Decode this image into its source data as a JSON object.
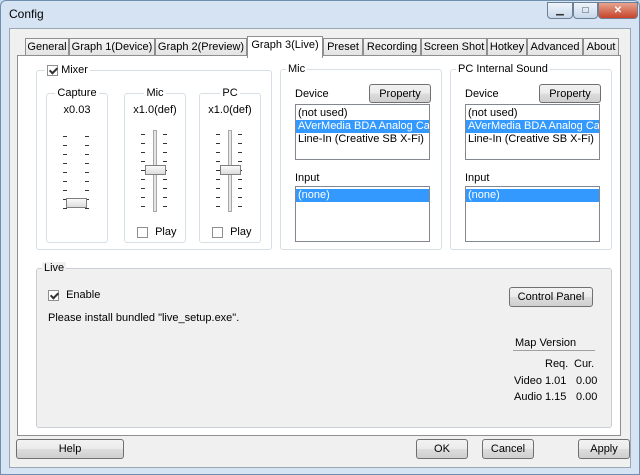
{
  "window": {
    "title": "Config"
  },
  "tabs": [
    {
      "label": "General"
    },
    {
      "label": "Graph 1(Device)"
    },
    {
      "label": "Graph 2(Preview)"
    },
    {
      "label": "Graph 3(Live)",
      "active": true
    },
    {
      "label": "Preset"
    },
    {
      "label": "Recording"
    },
    {
      "label": "Screen Shot"
    },
    {
      "label": "Hotkey"
    },
    {
      "label": "Advanced"
    },
    {
      "label": "About"
    }
  ],
  "mixer": {
    "enabled": true,
    "label": "Mixer",
    "capture": {
      "label": "Capture",
      "value": "x0.03"
    },
    "mic": {
      "label": "Mic",
      "value": "x1.0(def)",
      "play_label": "Play",
      "play": false
    },
    "pc": {
      "label": "PC",
      "value": "x1.0(def)",
      "play_label": "Play",
      "play": false
    }
  },
  "mic": {
    "title": "Mic",
    "device_label": "Device",
    "property_label": "Property",
    "devices": [
      "(not used)",
      "AVerMedia BDA Analog Cap",
      "Line-In (Creative SB X-Fi)"
    ],
    "selected_device_index": 1,
    "input_label": "Input",
    "inputs": [
      "(none)"
    ]
  },
  "pc_sound": {
    "title": "PC Internal Sound",
    "device_label": "Device",
    "property_label": "Property",
    "devices": [
      "(not used)",
      "AVerMedia BDA Analog Cap",
      "Line-In (Creative SB X-Fi)"
    ],
    "selected_device_index": 1,
    "input_label": "Input",
    "inputs": [
      "(none)"
    ]
  },
  "live": {
    "title": "Live",
    "enable_label": "Enable",
    "enabled": true,
    "message": "Please install bundled \"live_setup.exe\".",
    "control_panel_label": "Control Panel",
    "map_version_label": "Map Version",
    "req_label": "Req.",
    "cur_label": "Cur.",
    "video": {
      "label": "Video",
      "req": "1.01",
      "cur": "0.00"
    },
    "audio": {
      "label": "Audio",
      "req": "1.15",
      "cur": "0.00"
    }
  },
  "buttons": {
    "help": "Help",
    "ok": "OK",
    "cancel": "Cancel",
    "apply": "Apply"
  }
}
